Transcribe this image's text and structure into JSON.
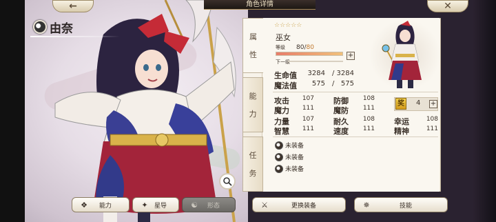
{
  "header": {
    "title": "角色详情",
    "back_icon": "arrow-left-icon",
    "close_icon": "close-x-icon"
  },
  "character": {
    "name": "由奈",
    "rarity_stars": 5,
    "stars_text": "☆☆☆☆☆",
    "job": "巫女"
  },
  "level": {
    "label": "等级",
    "current": "80",
    "separator": "/",
    "max": "80",
    "next_label": "下一级",
    "progress": 1.0
  },
  "vitals": [
    {
      "label": "生命值",
      "current": "3284",
      "sep": "/",
      "max": "3284"
    },
    {
      "label": "魔法值",
      "current": "575",
      "sep": "/",
      "max": "575"
    }
  ],
  "stats": {
    "row1": [
      {
        "label": "攻击",
        "value": "107"
      },
      {
        "label": "防御",
        "value": "108"
      }
    ],
    "row2": [
      {
        "label": "魔力",
        "value": "111"
      },
      {
        "label": "魔防",
        "value": "111"
      }
    ],
    "row3": [
      {
        "label": "力量",
        "value": "107"
      },
      {
        "label": "耐久",
        "value": "108"
      },
      {
        "label": "幸运",
        "value": "108"
      }
    ],
    "row4": [
      {
        "label": "智慧",
        "value": "111"
      },
      {
        "label": "速度",
        "value": "111"
      },
      {
        "label": "精神",
        "value": "111"
      }
    ]
  },
  "skill_points": {
    "icon_text": "奖",
    "value": "4"
  },
  "equipment": [
    {
      "label": "未装备"
    },
    {
      "label": "未装备"
    },
    {
      "label": "未装备"
    }
  ],
  "tabs": {
    "attribute": [
      "属",
      "性"
    ],
    "ability": [
      "能",
      "力"
    ],
    "quest": [
      "任",
      "务"
    ]
  },
  "buttons": {
    "ability": "能力",
    "star": "星导",
    "form": "形态",
    "change_equip": "更换装备",
    "skill": "技能"
  },
  "colors": {
    "accent_gold": "#c9a34c",
    "panel_bg": "#faf7f0",
    "text": "#3b3129",
    "level_max": "#c0792f"
  }
}
